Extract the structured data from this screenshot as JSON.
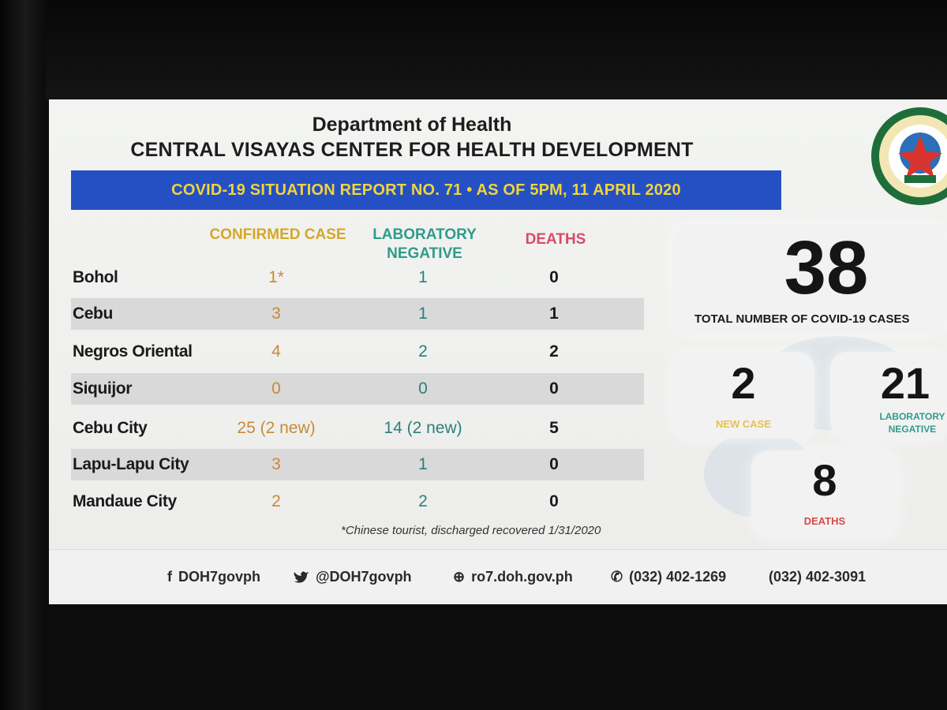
{
  "header": {
    "title": "Department of Health",
    "subtitle": "CENTRAL VISAYAS CENTER FOR HEALTH DEVELOPMENT",
    "banner": "COVID-19 SITUATION REPORT NO. 71 • AS OF 5PM, 11 APRIL 2020"
  },
  "table": {
    "columns": [
      "CONFIRMED CASE",
      "LABORATORY NEGATIVE",
      "DEATHS"
    ],
    "rows": [
      {
        "name": "Bohol",
        "confirmed": "1*",
        "lab_negative": "1",
        "deaths": "0"
      },
      {
        "name": "Cebu",
        "confirmed": "3",
        "lab_negative": "1",
        "deaths": "1"
      },
      {
        "name": "Negros Oriental",
        "confirmed": "4",
        "lab_negative": "2",
        "deaths": "2"
      },
      {
        "name": "Siquijor",
        "confirmed": "0",
        "lab_negative": "0",
        "deaths": "0"
      },
      {
        "name": "Cebu City",
        "confirmed": "25 (2 new)",
        "lab_negative": "14 (2 new)",
        "deaths": "5"
      },
      {
        "name": "Lapu-Lapu City",
        "confirmed": "3",
        "lab_negative": "1",
        "deaths": "0"
      },
      {
        "name": "Mandaue City",
        "confirmed": "2",
        "lab_negative": "2",
        "deaths": "0"
      }
    ],
    "footnote": "*Chinese tourist, discharged recovered 1/31/2020"
  },
  "stats": {
    "total": {
      "value": "38",
      "label": "TOTAL NUMBER OF COVID-19 CASES"
    },
    "new_case": {
      "value": "2",
      "label": "NEW CASE"
    },
    "lab_negative": {
      "value": "21",
      "label_line1": "LABORATORY",
      "label_line2": "NEGATIVE"
    },
    "deaths": {
      "value": "8",
      "label": "DEATHS"
    }
  },
  "footer": {
    "facebook": "DOH7govph",
    "twitter": "@DOH7govph",
    "website": "ro7.doh.gov.ph",
    "phone1": "(032) 402-1269",
    "phone2": "(032) 402-3091"
  },
  "colors": {
    "banner_bg": "#2450c4",
    "banner_text": "#f1d43a",
    "confirmed": "#d4a72a",
    "lab_negative": "#2f9b8a",
    "deaths": "#d84a6a"
  },
  "icons": [
    "seal-icon",
    "facebook-icon",
    "twitter-icon",
    "globe-icon",
    "phone-icon"
  ]
}
